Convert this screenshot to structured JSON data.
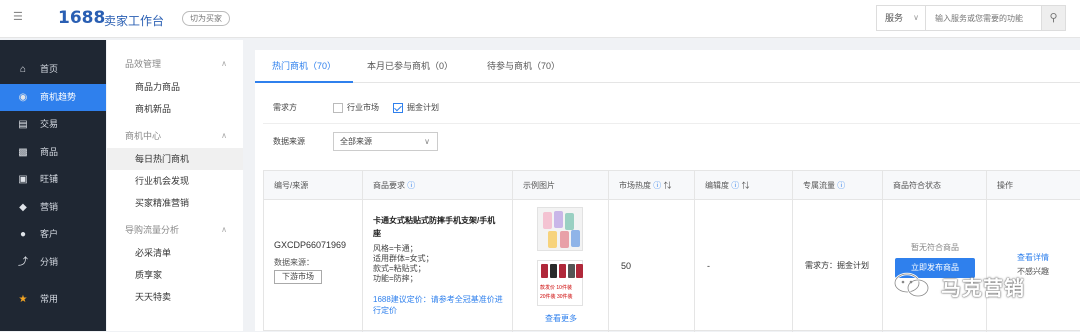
{
  "header": {
    "logo_num": "1688",
    "logo_text": "卖家工作台",
    "switch_label": "切为买家",
    "search": {
      "scope": "服务",
      "placeholder": "输入服务或您需要的功能"
    }
  },
  "sidebar": {
    "items": [
      {
        "label": "首页",
        "icon": "home-icon"
      },
      {
        "label": "商机趋势",
        "icon": "opportunity-icon",
        "active": true
      },
      {
        "label": "交易",
        "icon": "trade-icon"
      },
      {
        "label": "商品",
        "icon": "product-icon"
      },
      {
        "label": "旺铺",
        "icon": "shop-icon"
      },
      {
        "label": "营销",
        "icon": "tag-icon"
      },
      {
        "label": "客户",
        "icon": "user-icon"
      },
      {
        "label": "分销",
        "icon": "distribution-icon"
      },
      {
        "label": "常用",
        "icon": "star-icon"
      }
    ]
  },
  "subnav": {
    "groups": [
      {
        "title": "品效管理",
        "items": [
          "商品力商品",
          "商机新品"
        ]
      },
      {
        "title": "商机中心",
        "items": [
          "每日热门商机",
          "行业机会发现",
          "买家精准营销"
        ]
      },
      {
        "title": "导购流量分析",
        "items": [
          "必采清单",
          "质享家",
          "天天特卖"
        ]
      }
    ]
  },
  "tabs": [
    "热门商机（70）",
    "本月已参与商机（0）",
    "待参与商机（70）"
  ],
  "filters": {
    "demand_label": "需求方",
    "option1": "行业市场",
    "option2": "掘金计划",
    "source_label": "数据来源",
    "source_value": "全部来源"
  },
  "table": {
    "headers": [
      "编号/来源",
      "商品要求",
      "示例图片",
      "市场热度",
      "编辑度",
      "专属流量",
      "商品符合状态",
      "操作"
    ],
    "row": {
      "code": "GXCDP66071969",
      "source_label": "数据来源：",
      "source_btn": "下游市场",
      "title": "卡通女式粘贴式防摔手机支架/手机座",
      "attrs": [
        "风格=卡通；",
        "适用群体=女式；",
        "款式=粘贴式；",
        "功能=防摔；"
      ],
      "price": "1688建议定价：请参考全冠基准价进行定价",
      "thumb_text1": "款发价 10件装",
      "thumb_text2": "20件装 30件装",
      "see_more": "查看更多",
      "heat": "50",
      "fav": "-",
      "traffic": "需求方：掘金计划",
      "status_note": "暂无符合商品",
      "publish": "立即发布商品",
      "action1": "查看详情",
      "action2": "不感兴趣"
    }
  },
  "watermark": "马克营销",
  "colors": {
    "accent": "#2f80ed",
    "sidebar": "#1f2733"
  }
}
